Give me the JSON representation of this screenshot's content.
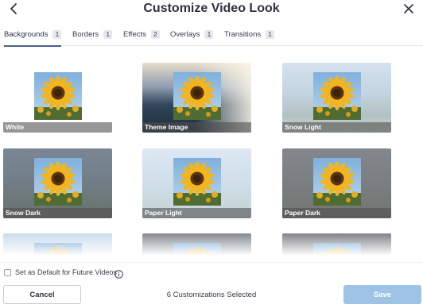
{
  "header": {
    "title": "Customize Video Look",
    "back_icon": "chevron-left-icon",
    "close_icon": "close-icon"
  },
  "tabs": [
    {
      "label": "Backgrounds",
      "count": "1",
      "active": true
    },
    {
      "label": "Borders",
      "count": "1",
      "active": false
    },
    {
      "label": "Effects",
      "count": "2",
      "active": false
    },
    {
      "label": "Overlays",
      "count": "1",
      "active": false
    },
    {
      "label": "Transitions",
      "count": "1",
      "active": false
    }
  ],
  "backgrounds": [
    {
      "label": "White"
    },
    {
      "label": "Theme Image"
    },
    {
      "label": "Snow Light"
    },
    {
      "label": "Snow Dark"
    },
    {
      "label": "Paper Light"
    },
    {
      "label": "Paper Dark"
    },
    {
      "label": ""
    },
    {
      "label": ""
    },
    {
      "label": ""
    }
  ],
  "footer": {
    "default_label": "Set as Default for Future Videos",
    "info_icon": "info-icon",
    "cancel_label": "Cancel",
    "selected_text": "6 Customizations Selected",
    "save_label": "Save"
  },
  "colors": {
    "accent": "#4a5f8a",
    "save_button": "#9ec3e6",
    "title_text": "#2f3142"
  }
}
